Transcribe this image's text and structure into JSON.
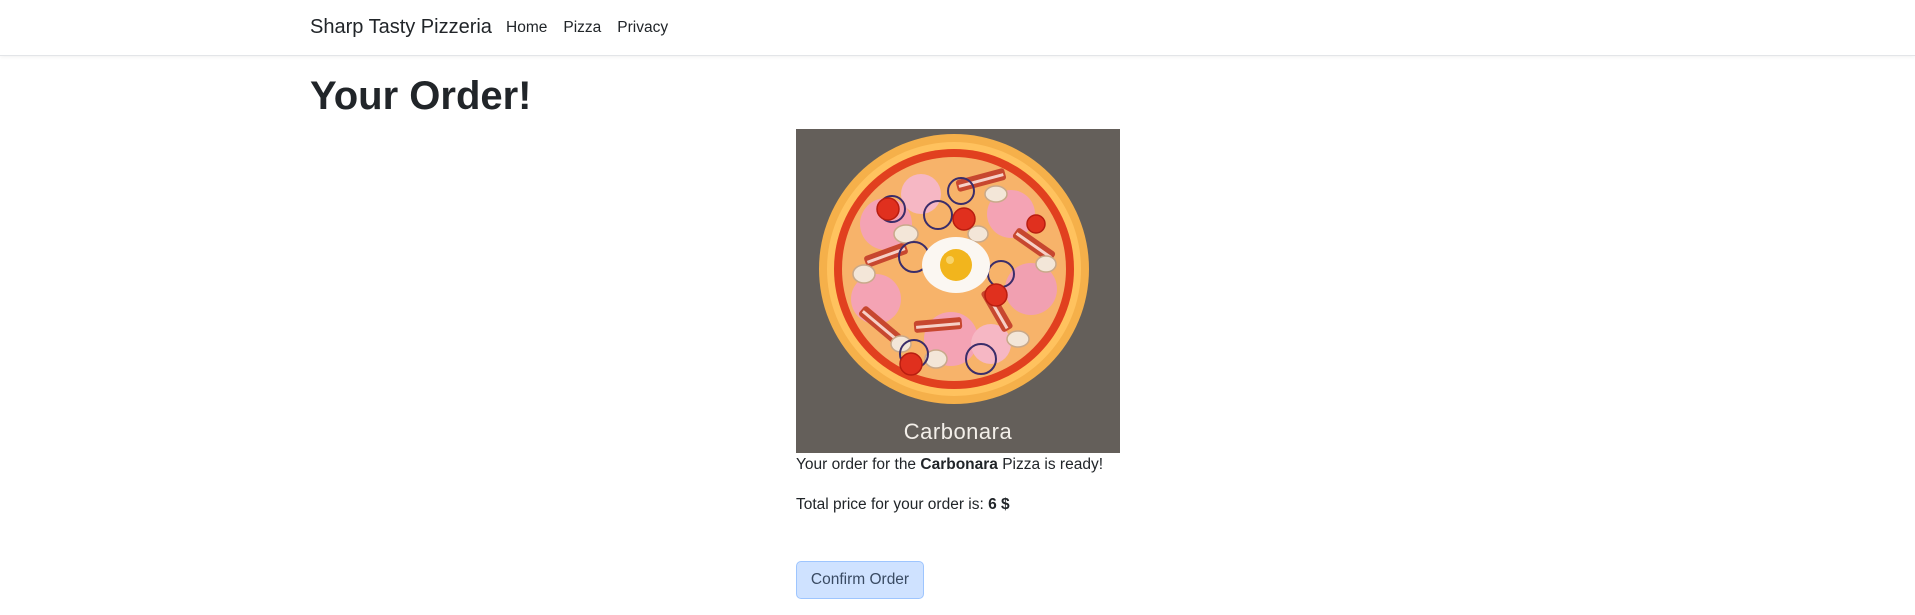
{
  "navbar": {
    "brand": "Sharp Tasty Pizzeria",
    "links": [
      "Home",
      "Pizza",
      "Privacy"
    ]
  },
  "page": {
    "title": "Your Order!"
  },
  "order": {
    "image_label": "Carbonara",
    "message_prefix": "Your order for the ",
    "pizza_name": "Carbonara",
    "message_suffix": " Pizza is ready!",
    "price_prefix": "Total price for your order is: ",
    "price_value": "6 $",
    "confirm_label": "Confirm Order"
  },
  "colors": {
    "image_background": "#645f5a",
    "button_background": "#cfe2ff"
  }
}
